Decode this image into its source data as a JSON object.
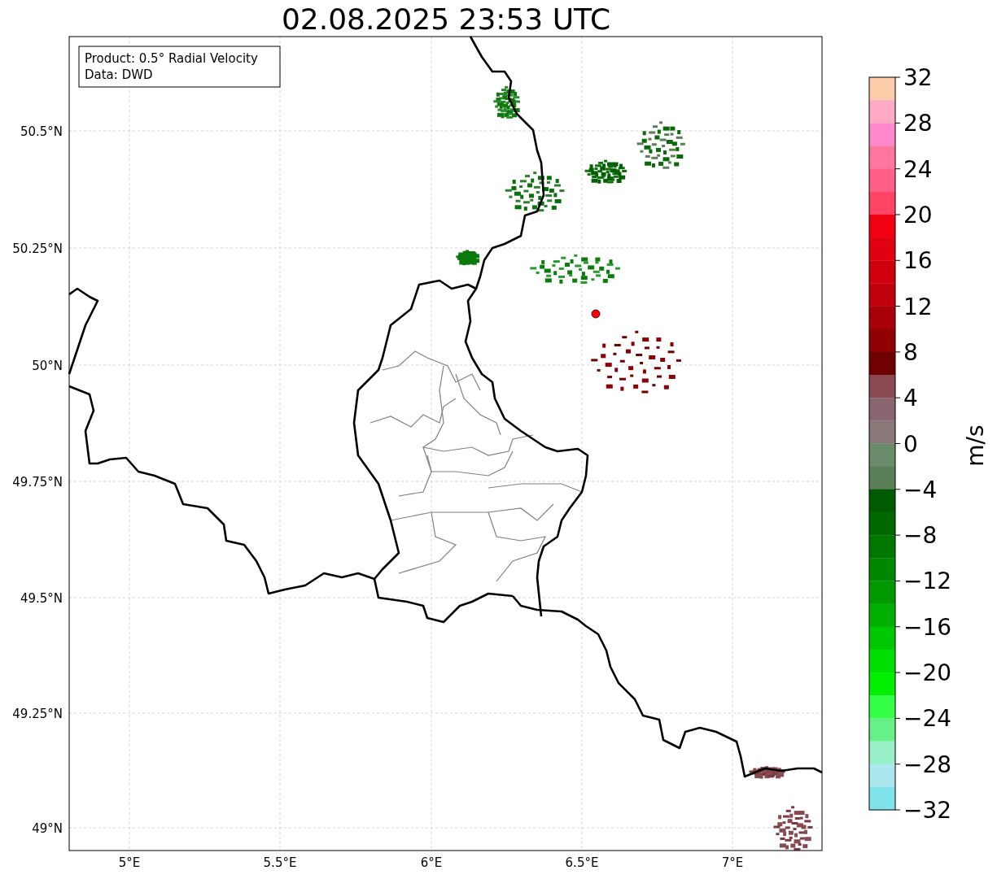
{
  "title": "02.08.2025 23:53 UTC",
  "info_box": [
    "Product: 0.5° Radial Velocity",
    "Data: DWD"
  ],
  "map": {
    "xticks": [
      "5°E",
      "5.5°E",
      "6°E",
      "6.5°E",
      "7°E"
    ],
    "yticks": [
      "50.5°N",
      "50.25°N",
      "50°N",
      "49.75°N",
      "49.5°N",
      "49.25°N",
      "49°N"
    ]
  },
  "colorbar": {
    "label": "m/s",
    "ticks": [
      "32",
      "28",
      "24",
      "20",
      "16",
      "12",
      "8",
      "4",
      "0",
      "−4",
      "−8",
      "−12",
      "−16",
      "−20",
      "−24",
      "−28",
      "−32"
    ],
    "segments": [
      {
        "color": "#ffccaa"
      },
      {
        "color": "#ffaac4"
      },
      {
        "color": "#ff88cc"
      },
      {
        "color": "#ff77a0"
      },
      {
        "color": "#ff5f88"
      },
      {
        "color": "#ff4466"
      },
      {
        "color": "#f00010"
      },
      {
        "color": "#e0000f"
      },
      {
        "color": "#d0000c"
      },
      {
        "color": "#c0000a"
      },
      {
        "color": "#aa0008"
      },
      {
        "color": "#900005"
      },
      {
        "color": "#700000"
      },
      {
        "color": "#8a4a52"
      },
      {
        "color": "#8a6670"
      },
      {
        "color": "#8a7878"
      },
      {
        "color": "#6a8a6c"
      },
      {
        "color": "#5a7e58"
      },
      {
        "color": "#005a00"
      },
      {
        "color": "#006800"
      },
      {
        "color": "#007800"
      },
      {
        "color": "#008800"
      },
      {
        "color": "#009a00"
      },
      {
        "color": "#00b000"
      },
      {
        "color": "#00c800"
      },
      {
        "color": "#00e000"
      },
      {
        "color": "#00f000"
      },
      {
        "color": "#33ff44"
      },
      {
        "color": "#66f088"
      },
      {
        "color": "#99f0c8"
      },
      {
        "color": "#aae8ee"
      },
      {
        "color": "#80e4ea"
      }
    ]
  }
}
